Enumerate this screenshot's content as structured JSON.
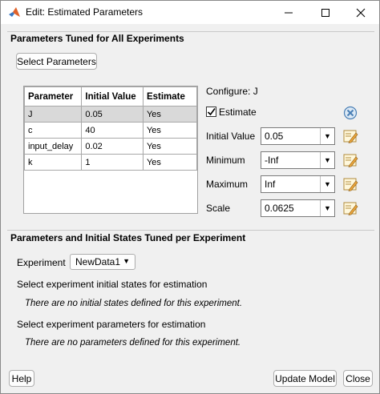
{
  "window": {
    "title": "Edit: Estimated Parameters",
    "icon": "matlab-icon"
  },
  "section1": {
    "header": "Parameters Tuned for All Experiments",
    "select_button": "Select Parameters",
    "table": {
      "columns": [
        "Parameter",
        "Initial Value",
        "Estimate"
      ],
      "rows": [
        [
          "J",
          "0.05",
          "Yes"
        ],
        [
          "c",
          "40",
          "Yes"
        ],
        [
          "input_delay",
          "0.02",
          "Yes"
        ],
        [
          "k",
          "1",
          "Yes"
        ]
      ],
      "selected_row": 0
    },
    "configure": "Configure: J",
    "estimate_label": "Estimate",
    "estimate_checked": true,
    "fields": {
      "initial_value": {
        "label": "Initial Value",
        "value": "0.05"
      },
      "minimum": {
        "label": "Minimum",
        "value": "-Inf"
      },
      "maximum": {
        "label": "Maximum",
        "value": "Inf"
      },
      "scale": {
        "label": "Scale",
        "value": "0.0625"
      }
    }
  },
  "section2": {
    "header": "Parameters and Initial States Tuned per Experiment",
    "experiment_label": "Experiment",
    "experiment_value": "NewData1",
    "initial_states_label": "Select experiment initial states for estimation",
    "initial_states_empty": "There are no initial states defined for this experiment.",
    "parameters_label": "Select experiment parameters for estimation",
    "parameters_empty": "There are no parameters defined for this experiment."
  },
  "footer": {
    "help": "Help",
    "update_model": "Update Model",
    "close": "Close"
  }
}
